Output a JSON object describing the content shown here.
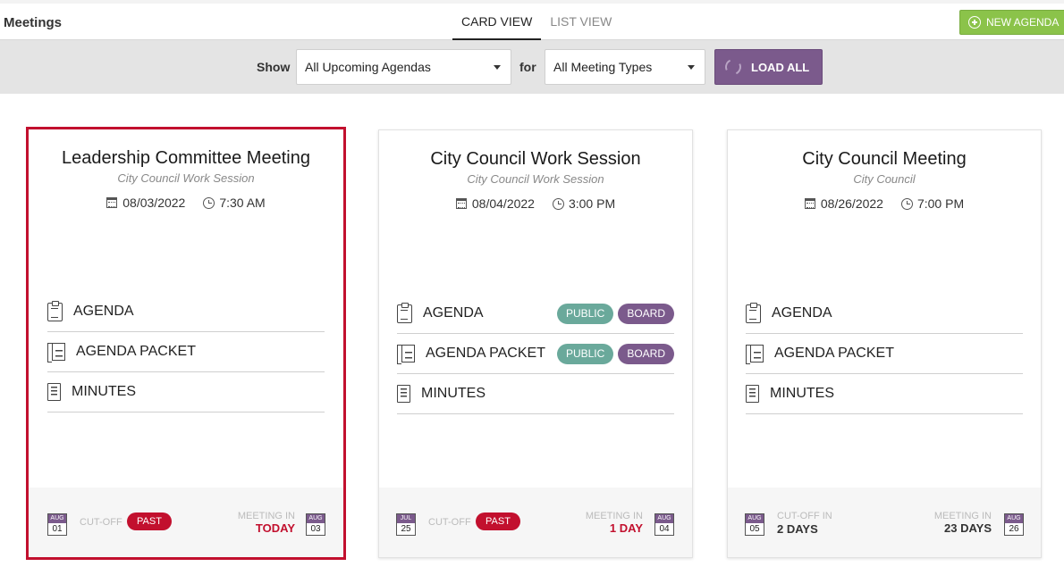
{
  "header": {
    "app_title": "Meetings",
    "tabs": [
      {
        "label": "CARD VIEW",
        "active": true
      },
      {
        "label": "LIST VIEW",
        "active": false
      }
    ],
    "new_agenda_label": "NEW AGENDA"
  },
  "filters": {
    "show_label": "Show",
    "show_value": "All Upcoming Agendas",
    "for_label": "for",
    "for_value": "All Meeting Types",
    "load_all_label": "LOAD ALL"
  },
  "cards": [
    {
      "title": "Leadership Committee Meeting",
      "subtitle": "City Council Work Session",
      "date": "08/03/2022",
      "time": "7:30 AM",
      "docs": [
        {
          "label": "AGENDA",
          "badges": []
        },
        {
          "label": "AGENDA PACKET",
          "badges": []
        },
        {
          "label": "MINUTES",
          "badges": []
        }
      ],
      "cutoff": {
        "month": "AUG",
        "day": "01",
        "label": "CUT-OFF",
        "status": "PAST"
      },
      "meeting": {
        "label": "MEETING IN",
        "value": "TODAY",
        "month": "AUG",
        "day": "03"
      }
    },
    {
      "title": "City Council Work Session",
      "subtitle": "City Council Work Session",
      "date": "08/04/2022",
      "time": "3:00 PM",
      "docs": [
        {
          "label": "AGENDA",
          "badges": [
            "PUBLIC",
            "BOARD"
          ]
        },
        {
          "label": "AGENDA PACKET",
          "badges": [
            "PUBLIC",
            "BOARD"
          ]
        },
        {
          "label": "MINUTES",
          "badges": []
        }
      ],
      "cutoff": {
        "month": "JUL",
        "day": "25",
        "label": "CUT-OFF",
        "status": "PAST"
      },
      "meeting": {
        "label": "MEETING IN",
        "value": "1 DAY",
        "month": "AUG",
        "day": "04"
      }
    },
    {
      "title": "City Council Meeting",
      "subtitle": "City Council",
      "date": "08/26/2022",
      "time": "7:00 PM",
      "docs": [
        {
          "label": "AGENDA",
          "badges": []
        },
        {
          "label": "AGENDA PACKET",
          "badges": []
        },
        {
          "label": "MINUTES",
          "badges": []
        }
      ],
      "cutoff": {
        "month": "AUG",
        "day": "05",
        "label": "CUT-OFF IN",
        "value": "2 DAYS"
      },
      "meeting": {
        "label": "MEETING IN",
        "value": "23 DAYS",
        "month": "AUG",
        "day": "26"
      }
    }
  ],
  "colors": {
    "accent": "#7b5a8c",
    "danger": "#c2102e",
    "public": "#6aa99b",
    "success": "#8bc34a"
  }
}
